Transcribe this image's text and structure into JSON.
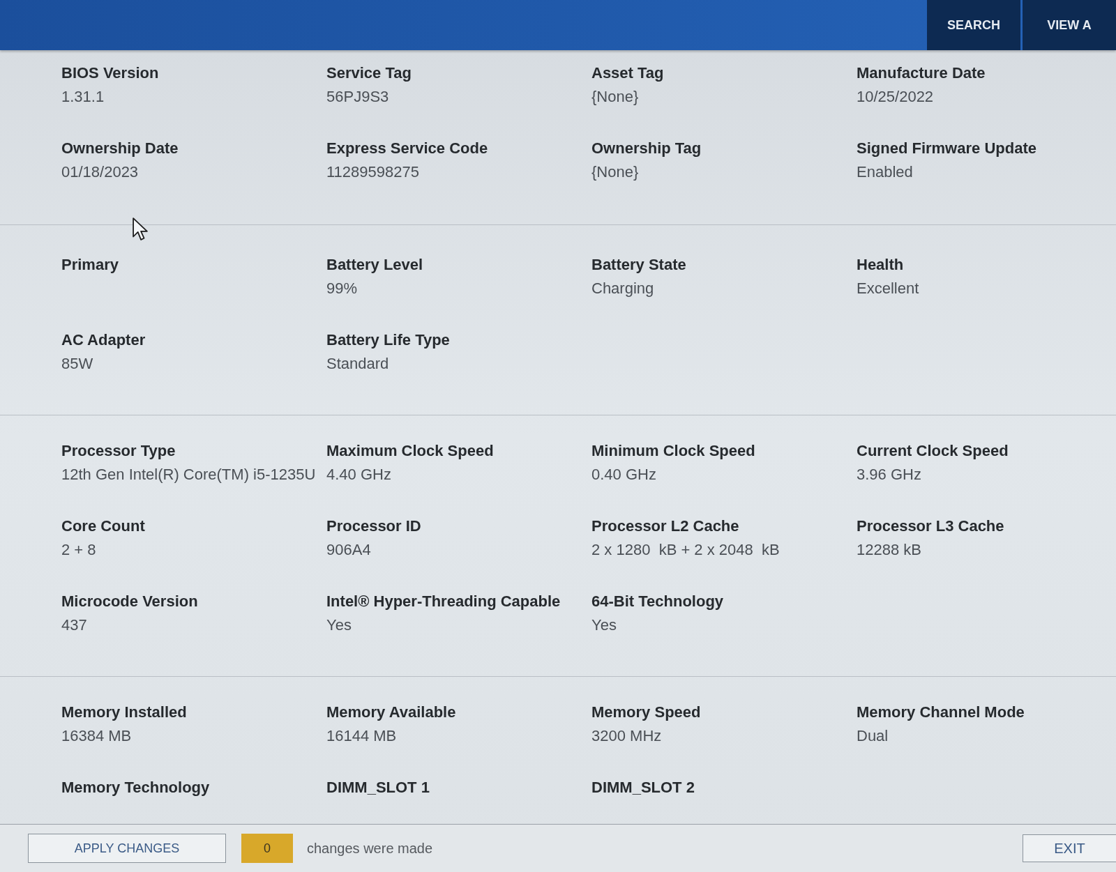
{
  "top_bar": {
    "tabs": [
      {
        "label": "SEARCH",
        "selected": false
      },
      {
        "label": "VIEW A",
        "selected": false
      }
    ]
  },
  "sections": [
    {
      "rows": [
        [
          {
            "label": "BIOS Version",
            "value": "1.31.1"
          },
          {
            "label": "Service Tag",
            "value": "56PJ9S3"
          },
          {
            "label": "Asset Tag",
            "value": "{None}"
          },
          {
            "label": "Manufacture Date",
            "value": "10/25/2022"
          }
        ],
        [
          {
            "label": "Ownership Date",
            "value": "01/18/2023"
          },
          {
            "label": "Express Service Code",
            "value": "11289598275"
          },
          {
            "label": "Ownership Tag",
            "value": "{None}"
          },
          {
            "label": "Signed Firmware Update",
            "value": "Enabled"
          }
        ]
      ]
    },
    {
      "rows": [
        [
          {
            "label": "Primary"
          },
          {
            "label": "Battery Level",
            "value": "99%"
          },
          {
            "label": "Battery State",
            "value": "Charging"
          },
          {
            "label": "Health",
            "value": "Excellent"
          }
        ],
        [
          {
            "label": "AC Adapter",
            "value": "85W"
          },
          {
            "label": "Battery Life Type",
            "value": "Standard"
          }
        ]
      ]
    },
    {
      "rows": [
        [
          {
            "label": "Processor Type",
            "value": "12th Gen Intel(R) Core(TM) i5-1235U"
          },
          {
            "label": "Maximum Clock Speed",
            "value": "4.40 GHz"
          },
          {
            "label": "Minimum Clock Speed",
            "value": "0.40 GHz"
          },
          {
            "label": "Current Clock Speed",
            "value": "3.96 GHz"
          }
        ],
        [
          {
            "label": "Core Count",
            "value": "2 + 8"
          },
          {
            "label": "Processor ID",
            "value": "906A4"
          },
          {
            "label": "Processor L2 Cache",
            "value": "2 x 1280  kB + 2 x 2048  kB"
          },
          {
            "label": "Processor L3 Cache",
            "value": "12288 kB"
          }
        ],
        [
          {
            "label": "Microcode Version",
            "value": "437"
          },
          {
            "label": "Intel® Hyper-Threading Capable",
            "value": "Yes"
          },
          {
            "label": "64-Bit Technology",
            "value": "Yes"
          }
        ]
      ]
    },
    {
      "rows": [
        [
          {
            "label": "Memory Installed",
            "value": "16384 MB"
          },
          {
            "label": "Memory Available",
            "value": "16144 MB"
          },
          {
            "label": "Memory Speed",
            "value": "3200 MHz"
          },
          {
            "label": "Memory Channel Mode",
            "value": "Dual"
          }
        ],
        [
          {
            "label": "Memory Technology"
          },
          {
            "label": "DIMM_SLOT 1"
          },
          {
            "label": "DIMM_SLOT 2"
          }
        ]
      ]
    }
  ],
  "footer": {
    "apply_button": "APPLY CHANGES",
    "change_count": "0",
    "change_text": "changes were made",
    "exit_button": "EXIT"
  }
}
